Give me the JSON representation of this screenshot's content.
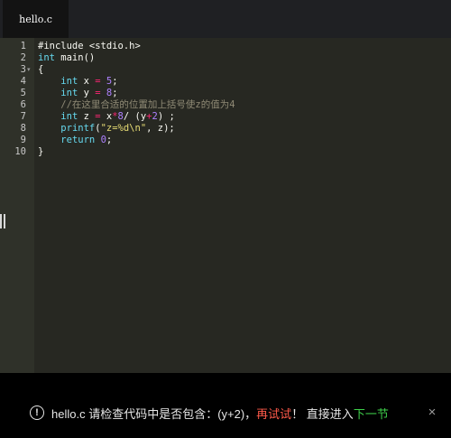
{
  "tab": {
    "filename": "hello.c"
  },
  "code": {
    "lines": [
      {
        "num": "1",
        "segments": [
          {
            "t": "#include <stdio.h>",
            "c": "pp"
          }
        ]
      },
      {
        "num": "2",
        "segments": [
          {
            "t": "int",
            "c": "kw"
          },
          {
            "t": " main()",
            "c": "pl"
          }
        ]
      },
      {
        "num": "3",
        "fold": "▾",
        "segments": [
          {
            "t": "{",
            "c": "pl"
          }
        ]
      },
      {
        "num": "4",
        "segments": [
          {
            "t": "    ",
            "c": "pl"
          },
          {
            "t": "int",
            "c": "kw"
          },
          {
            "t": " x ",
            "c": "pl"
          },
          {
            "t": "=",
            "c": "op"
          },
          {
            "t": " ",
            "c": "pl"
          },
          {
            "t": "5",
            "c": "num"
          },
          {
            "t": ";",
            "c": "pl"
          }
        ]
      },
      {
        "num": "5",
        "segments": [
          {
            "t": "    ",
            "c": "pl"
          },
          {
            "t": "int",
            "c": "kw"
          },
          {
            "t": " y ",
            "c": "pl"
          },
          {
            "t": "=",
            "c": "op"
          },
          {
            "t": " ",
            "c": "pl"
          },
          {
            "t": "8",
            "c": "num"
          },
          {
            "t": ";",
            "c": "pl"
          }
        ]
      },
      {
        "num": "6",
        "segments": [
          {
            "t": "    //在这里合适的位置加上括号使z的值为4",
            "c": "cm"
          }
        ]
      },
      {
        "num": "7",
        "segments": [
          {
            "t": "    ",
            "c": "pl"
          },
          {
            "t": "int",
            "c": "kw"
          },
          {
            "t": " z ",
            "c": "pl"
          },
          {
            "t": "=",
            "c": "op"
          },
          {
            "t": " x",
            "c": "pl"
          },
          {
            "t": "*",
            "c": "op"
          },
          {
            "t": "8",
            "c": "num"
          },
          {
            "t": "/ (y",
            "c": "pl"
          },
          {
            "t": "+",
            "c": "op"
          },
          {
            "t": "2",
            "c": "num"
          },
          {
            "t": ") ;",
            "c": "pl"
          }
        ]
      },
      {
        "num": "8",
        "segments": [
          {
            "t": "    ",
            "c": "pl"
          },
          {
            "t": "printf",
            "c": "kw"
          },
          {
            "t": "(",
            "c": "pl"
          },
          {
            "t": "\"z=%d\\n\"",
            "c": "str"
          },
          {
            "t": ", z);",
            "c": "pl"
          }
        ]
      },
      {
        "num": "9",
        "segments": [
          {
            "t": "    ",
            "c": "pl"
          },
          {
            "t": "return",
            "c": "kw"
          },
          {
            "t": " ",
            "c": "pl"
          },
          {
            "t": "0",
            "c": "num"
          },
          {
            "t": ";",
            "c": "pl"
          }
        ]
      },
      {
        "num": "10",
        "segments": [
          {
            "t": "}",
            "c": "pl"
          }
        ]
      }
    ]
  },
  "notice": {
    "icon": "!",
    "text": "hello.c 请检查代码中是否包含：(y+2)，",
    "retry": "再试试",
    "middle": "！ 直接进入",
    "next": "下一节",
    "close": "×"
  },
  "colors": {
    "editor_bg": "#272822",
    "keyword": "#66d9ef",
    "number": "#ae81ff",
    "string": "#e6db74",
    "operator": "#f92672",
    "comment": "#8f8a75",
    "retry": "#ff5a4a",
    "next": "#3ecf4a"
  }
}
